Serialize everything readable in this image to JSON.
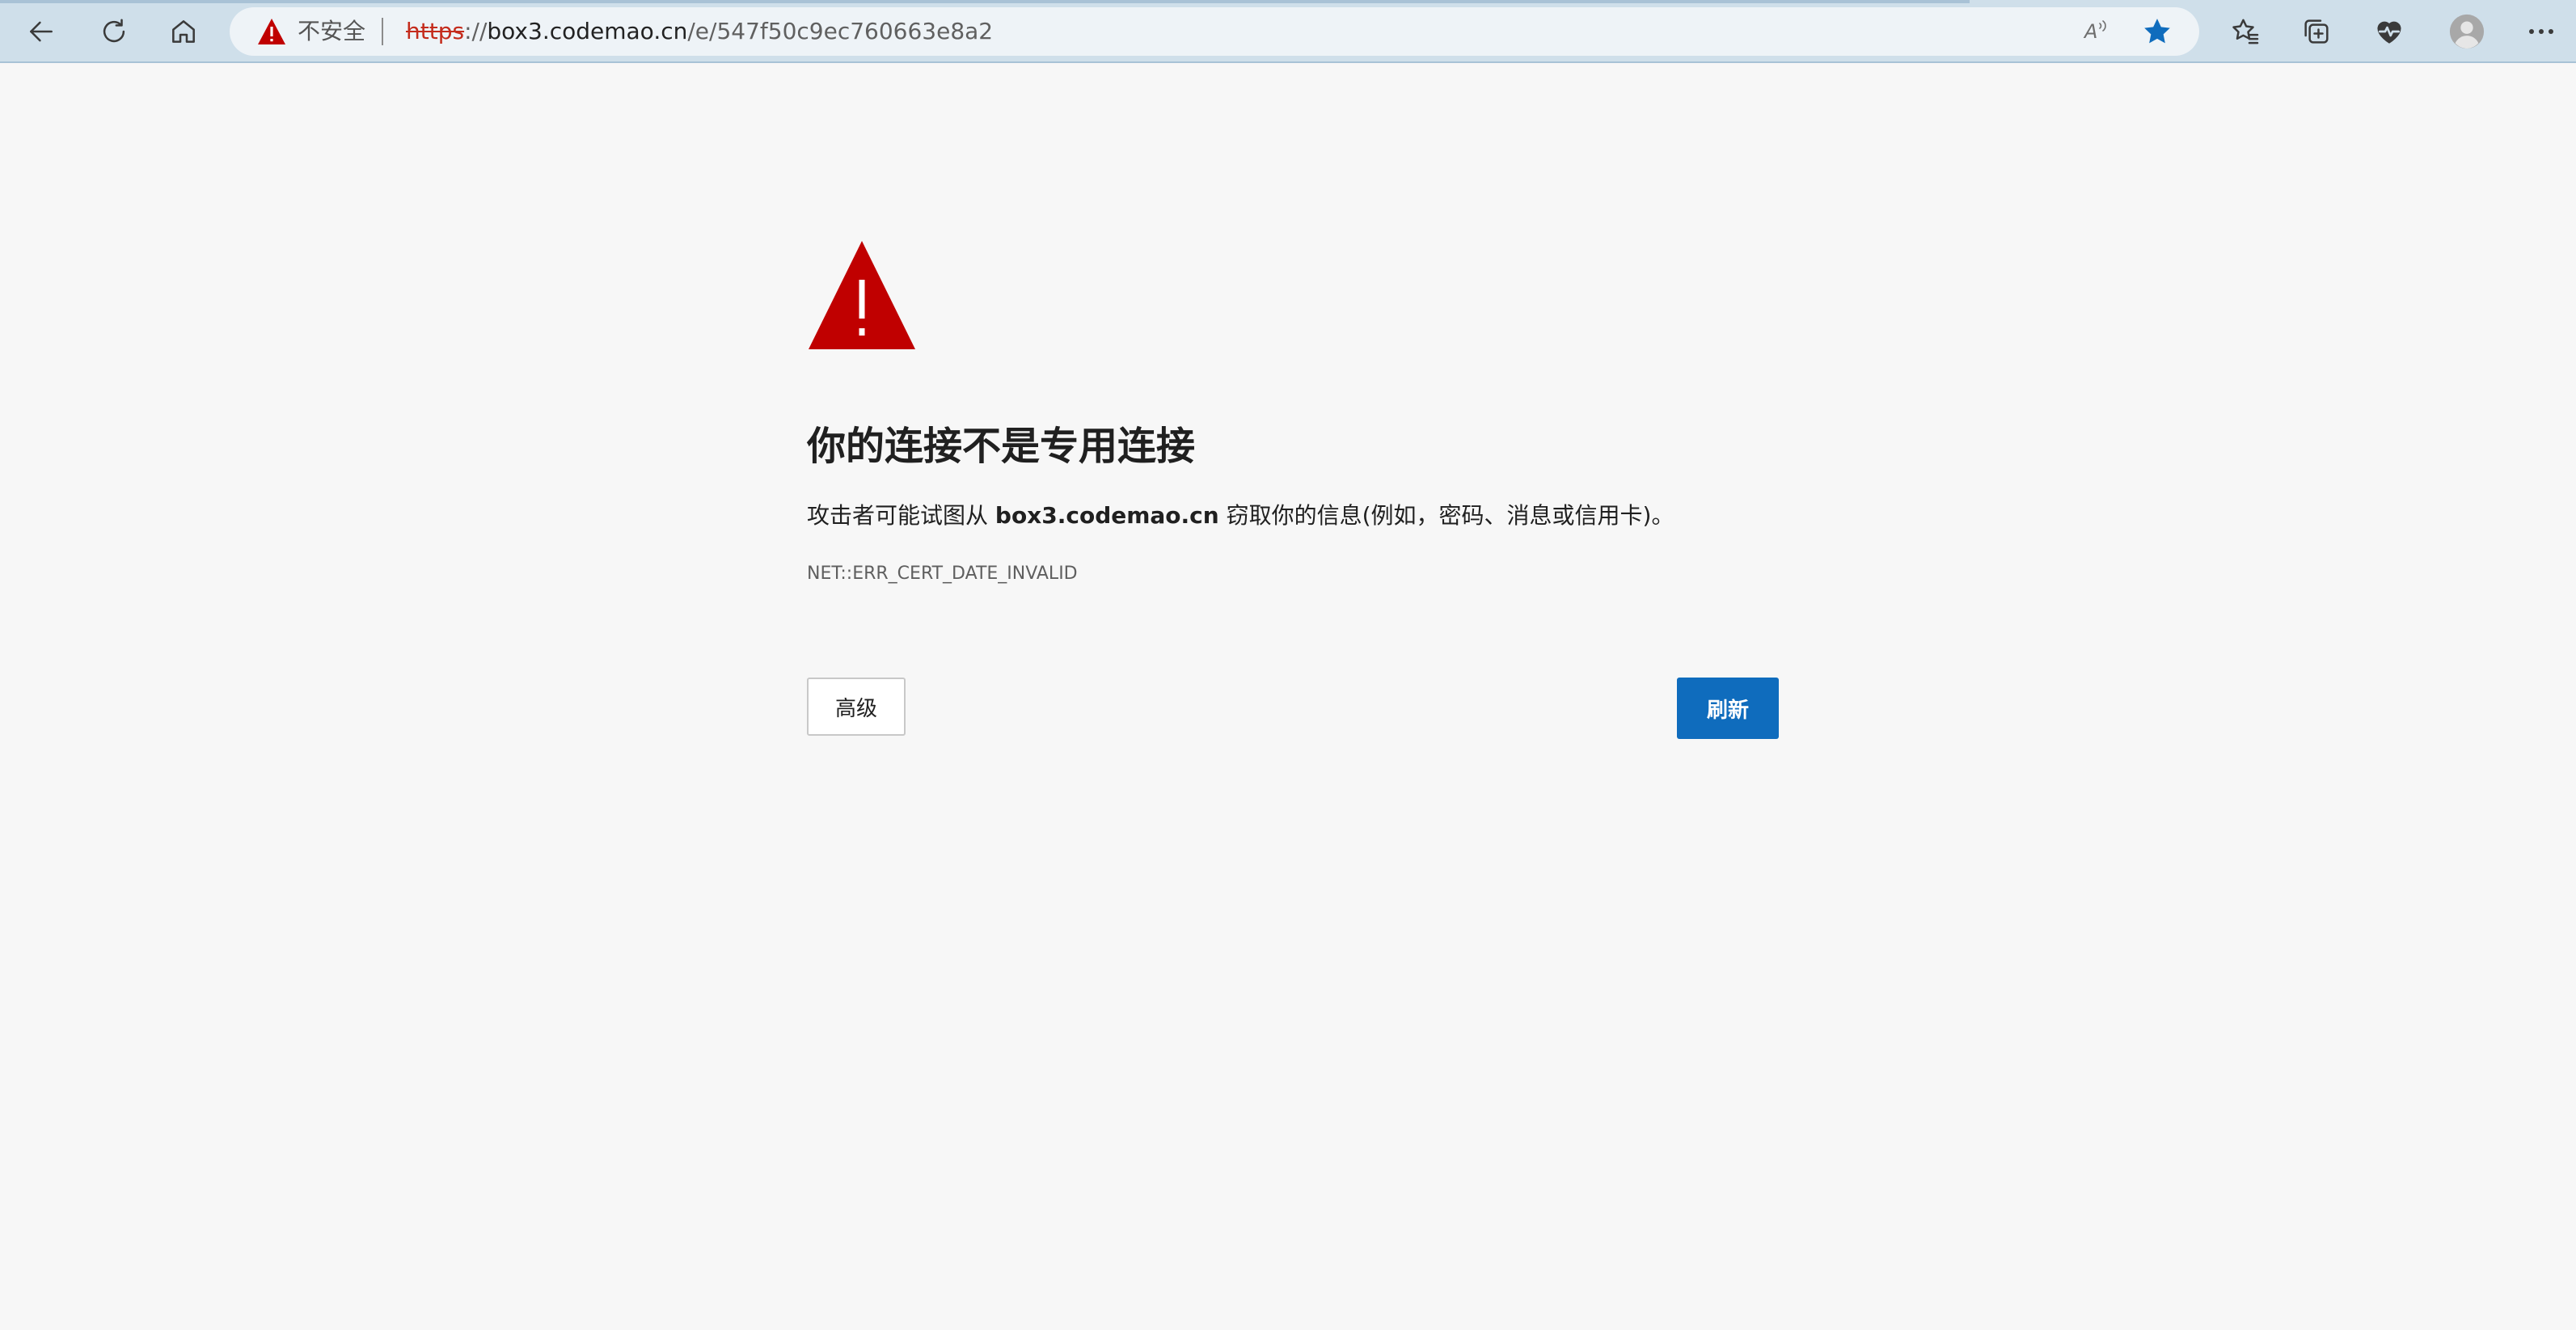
{
  "browser": {
    "address_bar": {
      "security_label": "不安全",
      "url_scheme": "https",
      "url_separator": "://",
      "url_host": "box3.codemao.cn",
      "url_path": "/e/547f50c9ec760663e8a2"
    },
    "read_aloud_label": "A",
    "icons": {
      "back": "back-arrow-icon",
      "refresh": "refresh-icon",
      "home": "home-icon",
      "warning": "warning-icon",
      "read_aloud": "read-aloud-icon",
      "favorite": "star-filled-icon",
      "favorites": "favorites-icon",
      "collections": "collections-icon",
      "browser_essentials": "heart-pulse-icon",
      "profile": "profile-avatar-icon",
      "more": "more-menu-icon"
    },
    "colors": {
      "toolbar": "#cfdfea",
      "address_bar": "#eef3f7",
      "warning_red": "#c00000",
      "star_blue": "#0f6cbd"
    }
  },
  "page": {
    "heading": "你的连接不是专用连接",
    "description_prefix": "攻击者可能试图从 ",
    "description_host": "box3.codemao.cn",
    "description_suffix": " 窃取你的信息(例如，密码、消息或信用卡)。",
    "error_code": "NET::ERR_CERT_DATE_INVALID",
    "advanced_button": "高级",
    "refresh_button": "刷新",
    "colors": {
      "background": "#f7f7f7",
      "primary_button": "#0f6cbd",
      "warning_triangle": "#c00000"
    }
  }
}
